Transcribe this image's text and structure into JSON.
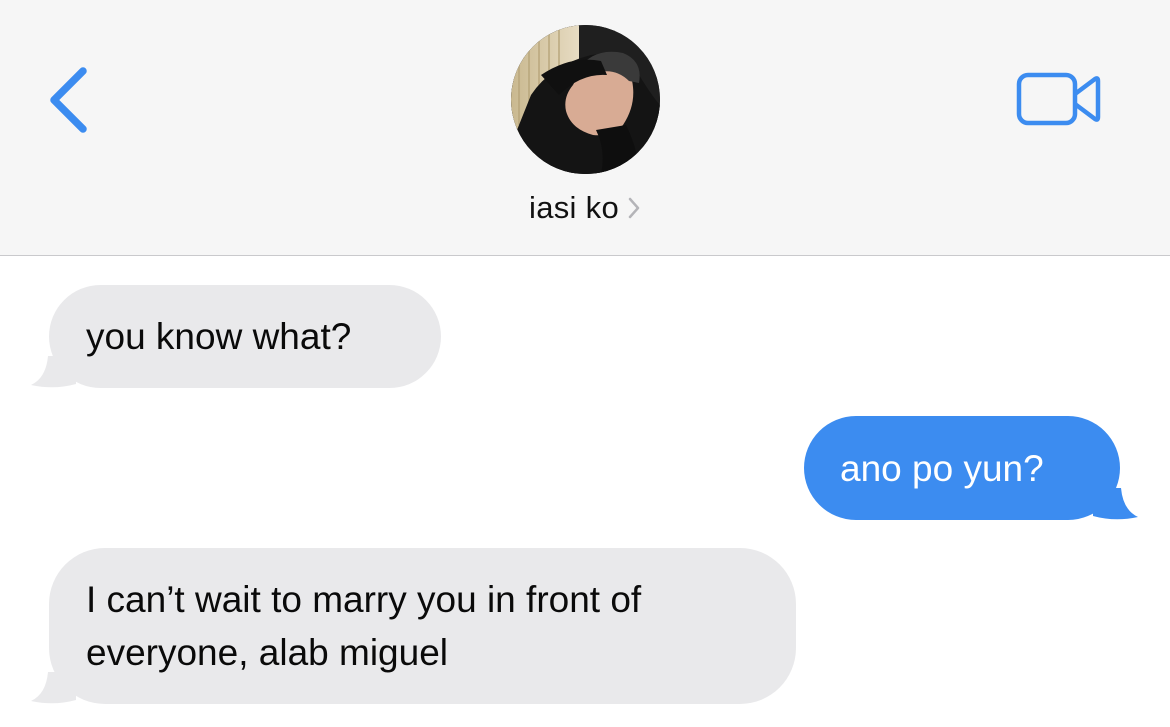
{
  "header": {
    "back_icon": "chevron-left-icon",
    "video_icon": "video-camera-icon",
    "contact_name": "iasi ko",
    "chevron_icon": "chevron-right-icon",
    "accent_color": "#3c8cf0"
  },
  "messages": [
    {
      "direction": "received",
      "text": "you know what?"
    },
    {
      "direction": "sent",
      "text": "ano po yun?"
    },
    {
      "direction": "received",
      "text": "I can’t wait to marry you in front of everyone, alab miguel"
    }
  ],
  "colors": {
    "received_bubble": "#e9e9eb",
    "sent_bubble": "#3c8cf0",
    "header_background": "#f6f6f6"
  }
}
